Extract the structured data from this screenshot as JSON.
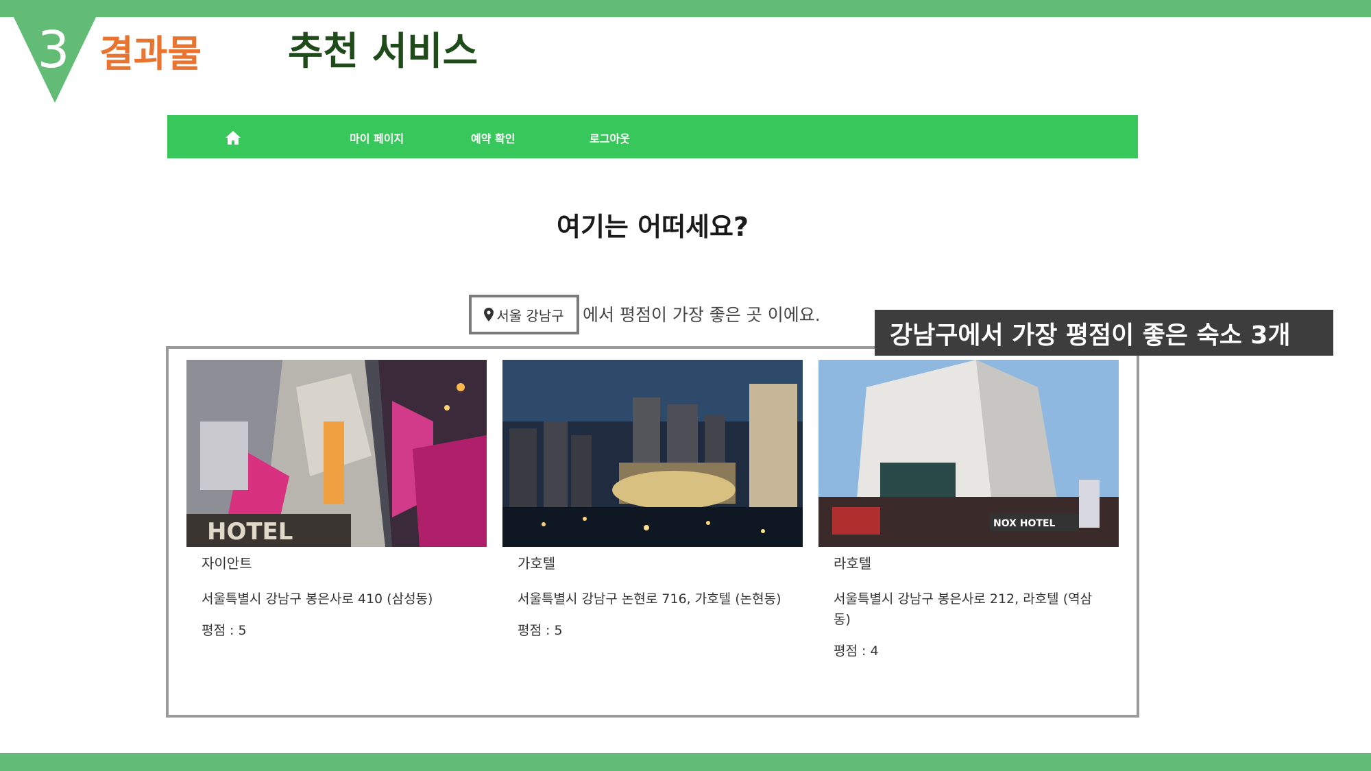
{
  "slide": {
    "section_number": "3",
    "section_label": "결과물",
    "title": "추천 서비스"
  },
  "navbar": {
    "home_icon": "home-icon",
    "items": [
      {
        "label": "마이 페이지"
      },
      {
        "label": "예약 확인"
      },
      {
        "label": "로그아웃"
      }
    ]
  },
  "page": {
    "heading": "여기는 어떠세요?",
    "location_icon": "map-pin-icon",
    "location": "서울 강남구",
    "subtitle": "에서 평점이 가장 좋은 곳 이에요."
  },
  "callout": "강남구에서 가장 평점이 좋은 숙소 3개",
  "hotels": [
    {
      "name": "자이안트",
      "address": "서울특별시 강남구 봉은사로 410 (삼성동)",
      "rating_text": "평점 : 5",
      "rating": 5,
      "photo_sign": "HOTEL"
    },
    {
      "name": "가호텔",
      "address": "서울특별시 강남구 논현로 716, 가호텔 (논현동)",
      "rating_text": "평점 : 5",
      "rating": 5
    },
    {
      "name": "라호텔",
      "address": "서울특별시 강남구 봉은사로 212, 라호텔 (역삼동)",
      "rating_text": "평점 : 4",
      "rating": 4,
      "photo_sign": "NOX HOTEL"
    }
  ],
  "colors": {
    "accent_bar": "#63bc75",
    "nav": "#37c75a",
    "section_label": "#e8742f",
    "title": "#1f4a19",
    "callout_bg": "#3d3d3d"
  }
}
